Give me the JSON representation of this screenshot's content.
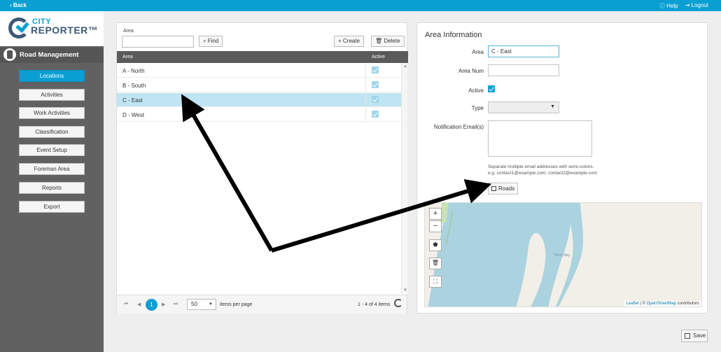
{
  "topbar": {
    "back_label": "Back",
    "help_label": "Help",
    "logout_label": "Logout"
  },
  "logo": {
    "city": "CITY",
    "reporter": "REPORTER™"
  },
  "module": {
    "title": "Road Management"
  },
  "nav": [
    {
      "label": "Locations",
      "active": true
    },
    {
      "label": "Activities"
    },
    {
      "label": "Work Activities"
    },
    {
      "label": "Classification"
    },
    {
      "label": "Event Setup"
    },
    {
      "label": "Foreman Area"
    },
    {
      "label": "Reports"
    },
    {
      "label": "Export"
    }
  ],
  "list": {
    "filter_label": "Area",
    "find_label": "Find",
    "create_label": "Create",
    "delete_label": "Delete",
    "columns": {
      "area": "Area",
      "active": "Active"
    },
    "rows": [
      {
        "name": "A - North",
        "active": true
      },
      {
        "name": "B - South",
        "active": true
      },
      {
        "name": "C - East",
        "active": true,
        "selected": true
      },
      {
        "name": "D - West",
        "active": true
      }
    ],
    "pager": {
      "page": "1",
      "page_size": "50",
      "items_per_page": "items per page",
      "count": "1 - 4 of 4 items"
    }
  },
  "detail": {
    "title": "Area Information",
    "area_label": "Area",
    "area_value": "C - East",
    "areanum_label": "Area Num",
    "areanum_value": "",
    "active_label": "Active",
    "type_label": "Type",
    "type_value": "",
    "email_label": "Notification Email(s)",
    "email_hint1": "Separate multiple email addresses with semi-colons.",
    "email_hint2": "e.g. contact1@example.com; contact2@example.com",
    "roads_label": "Roads"
  },
  "map": {
    "zoom_in": "+",
    "zoom_out": "−",
    "place_label": "Perry Bay",
    "attribution_leaflet": "Leaflet",
    "attribution_sep": " | © ",
    "attribution_osm": "OpenStreetMap",
    "attribution_suffix": " contributors"
  },
  "footer": {
    "save_label": "Save"
  }
}
